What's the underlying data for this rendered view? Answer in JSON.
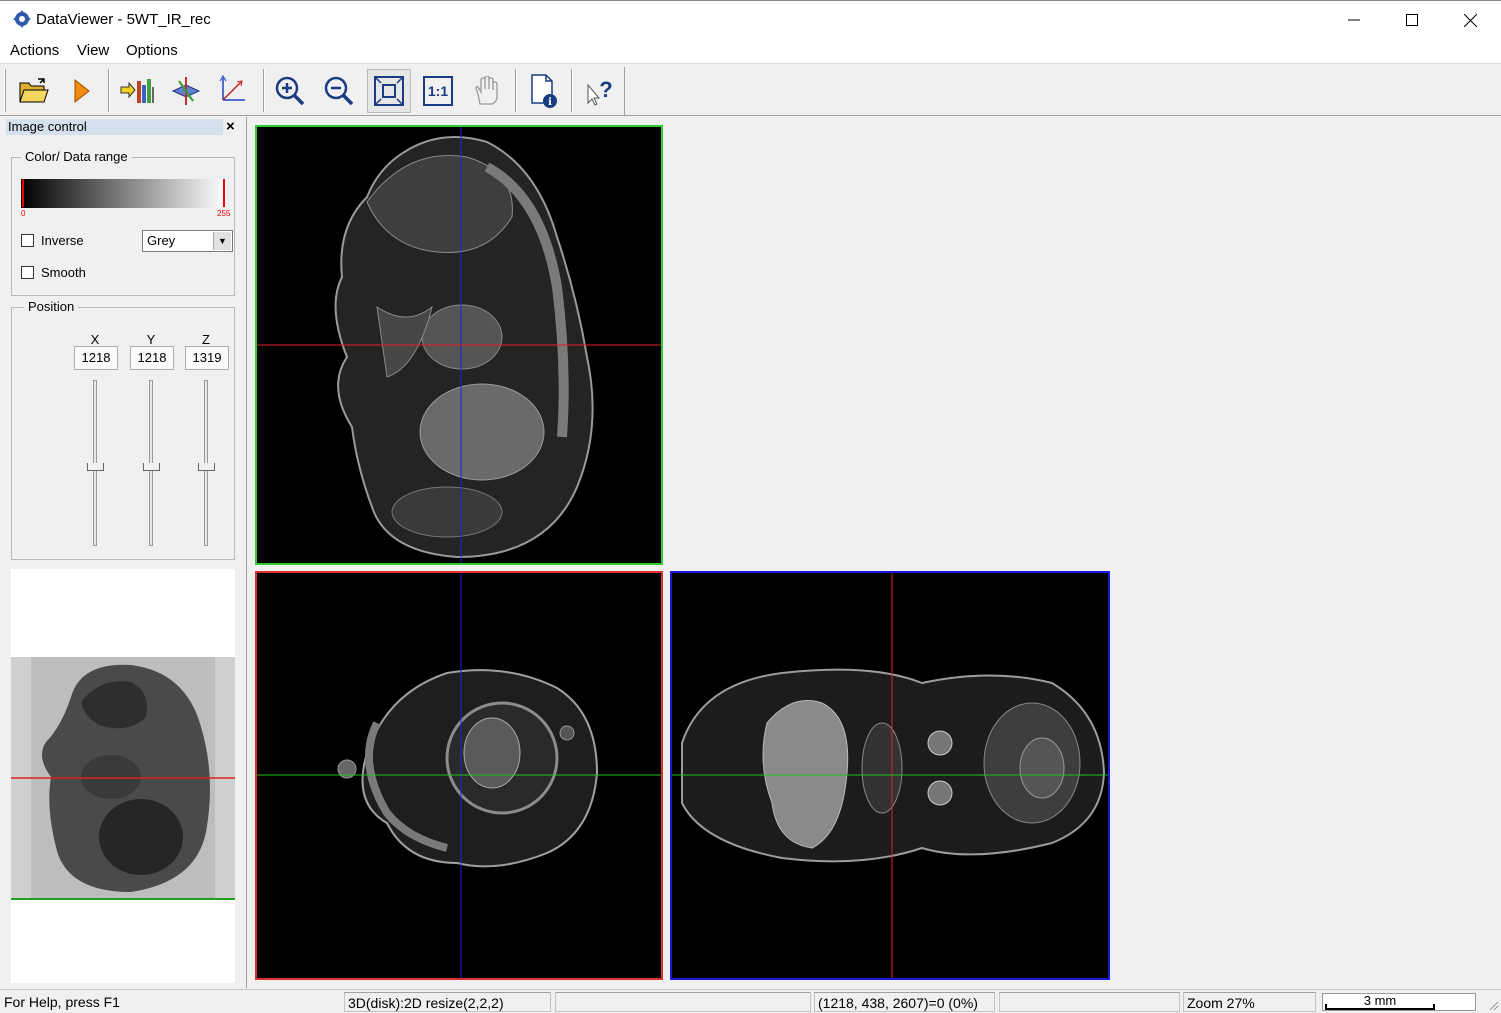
{
  "window": {
    "title": "DataViewer - 5WT_IR_rec",
    "minimize": "—",
    "maximize": "☐",
    "close": "✕"
  },
  "menu": [
    "Actions",
    "View",
    "Options"
  ],
  "toolbar": {
    "buttons": [
      "open-folder",
      "play",
      "sorting",
      "slice-planes",
      "3d-view",
      "zoom-in",
      "zoom-out",
      "fit-to-window",
      "actual-size",
      "pan-hand",
      "file-info",
      "context-help"
    ],
    "actual_size_label": "1:1",
    "three_d_label": "3D"
  },
  "panel": {
    "title": "Image control",
    "close": "×",
    "color_group": "Color/ Data range",
    "range_min": "0",
    "range_max": "255",
    "inverse_label": "Inverse",
    "smooth_label": "Smooth",
    "inverse_checked": false,
    "smooth_checked": false,
    "colormap": "Grey",
    "position_group": "Position",
    "axes": [
      "X",
      "Y",
      "Z"
    ],
    "values": [
      "1218",
      "1218",
      "1319"
    ]
  },
  "colors": {
    "sagittal_frame": "#33cc33",
    "coronal_frame": "#e03030",
    "axial_frame": "#1a1adc",
    "crosshair_red": "#e02020",
    "crosshair_blue": "#2020e0",
    "crosshair_green": "#20c020"
  },
  "status": {
    "help": "For Help, press F1",
    "mode": "3D(disk):2D resize(2,2,2)",
    "empty1": "",
    "coordinates": "(1218, 438, 2607)=0 (0%)",
    "empty2": "",
    "zoom": "Zoom 27%",
    "scale": "3 mm"
  }
}
